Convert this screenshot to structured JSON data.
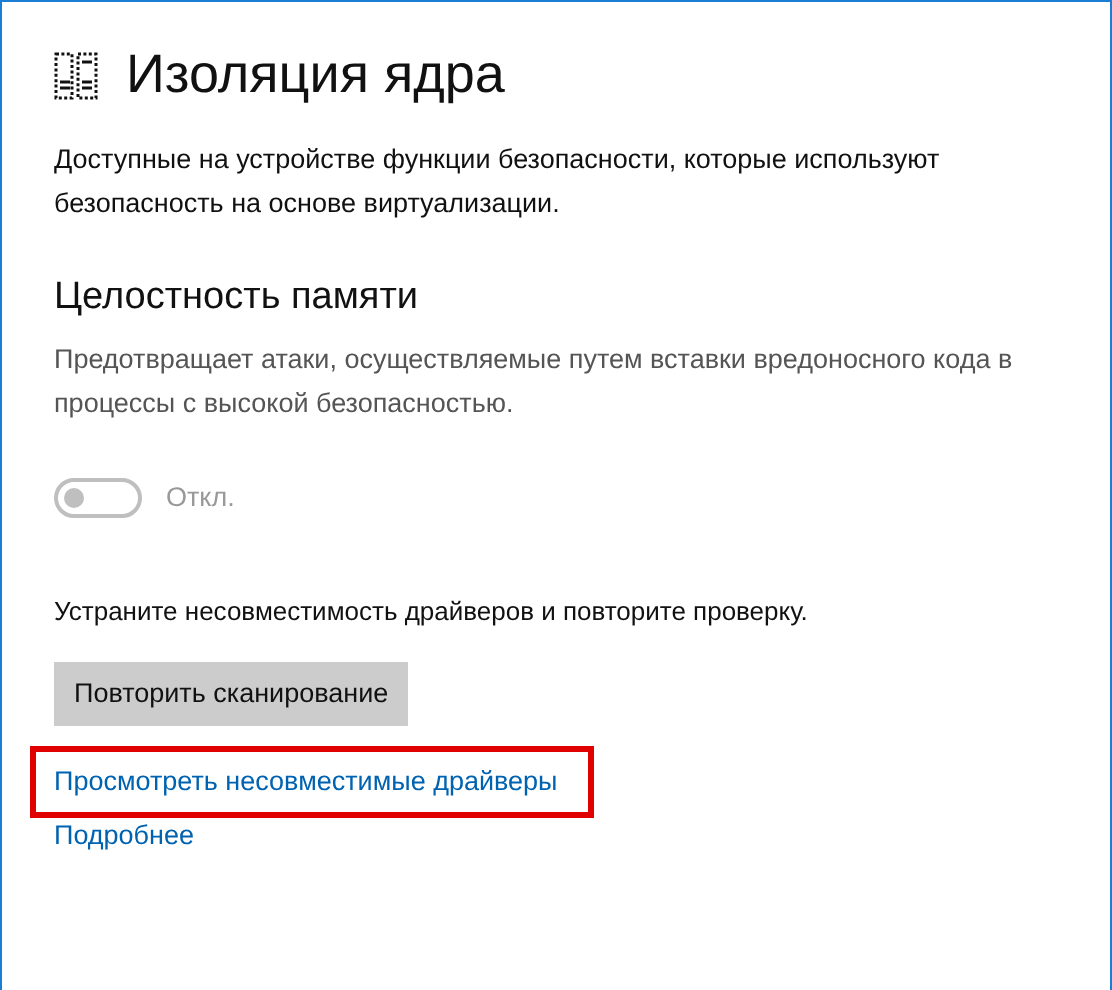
{
  "page": {
    "title": "Изоляция ядра",
    "description": "Доступные на устройстве функции безопасности, которые используют безопасность на основе виртуализации."
  },
  "section": {
    "title": "Целостность памяти",
    "description": "Предотвращает атаки, осуществляемые путем вставки вредоносного кода в процессы с высокой безопасностью.",
    "toggle": {
      "on": false,
      "disabled": true,
      "label": "Откл."
    }
  },
  "notice": "Устраните несовместимость драйверов и повторите проверку.",
  "button": "Повторить сканирование",
  "links": [
    {
      "label": "Просмотреть несовместимые драйверы",
      "highlighted": true
    },
    {
      "label": "Подробнее",
      "highlighted": false
    }
  ]
}
